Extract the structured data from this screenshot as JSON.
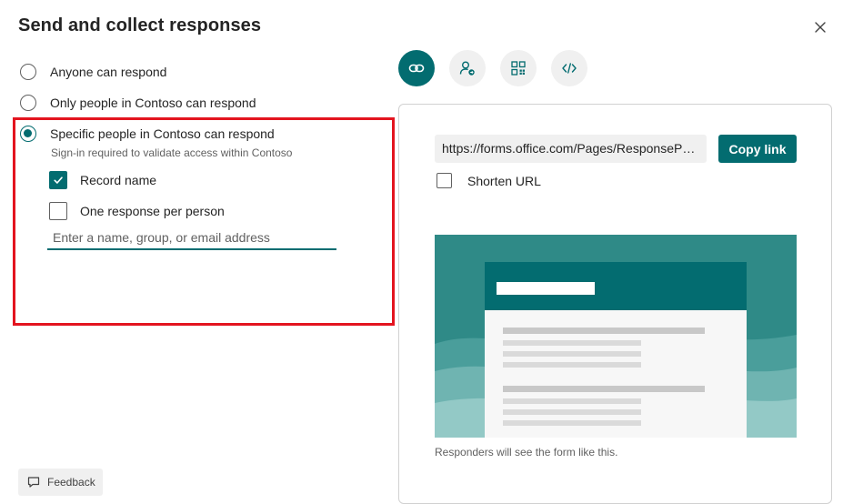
{
  "dialog": {
    "title": "Send and collect responses",
    "close_icon": "close-icon"
  },
  "audience": {
    "options": [
      {
        "label": "Anyone can respond",
        "selected": false
      },
      {
        "label": "Only people in Contoso can respond",
        "selected": false
      },
      {
        "label": "Specific people in Contoso can respond",
        "selected": true
      }
    ],
    "specific_note": "Sign-in required to validate access within Contoso",
    "record_name": {
      "label": "Record name",
      "checked": true
    },
    "one_response": {
      "label": "One response per person",
      "checked": false
    },
    "people_input": {
      "placeholder": "Enter a name, group, or email address",
      "value": ""
    },
    "highlight_color": "#e3141f"
  },
  "share_tabs": [
    {
      "icon": "link-icon",
      "active": true
    },
    {
      "icon": "person-share-icon",
      "active": false
    },
    {
      "icon": "qr-code-icon",
      "active": false
    },
    {
      "icon": "embed-code-icon",
      "active": false
    }
  ],
  "link_panel": {
    "url": "https://forms.office.com/Pages/ResponsePage.aspx",
    "copy_label": "Copy link",
    "shorten_label": "Shorten URL",
    "shorten_checked": false,
    "preview_caption": "Responders will see the form like this."
  },
  "feedback_label": "Feedback",
  "colors": {
    "accent": "#036c70",
    "preview_bg": "#2f8a87"
  }
}
